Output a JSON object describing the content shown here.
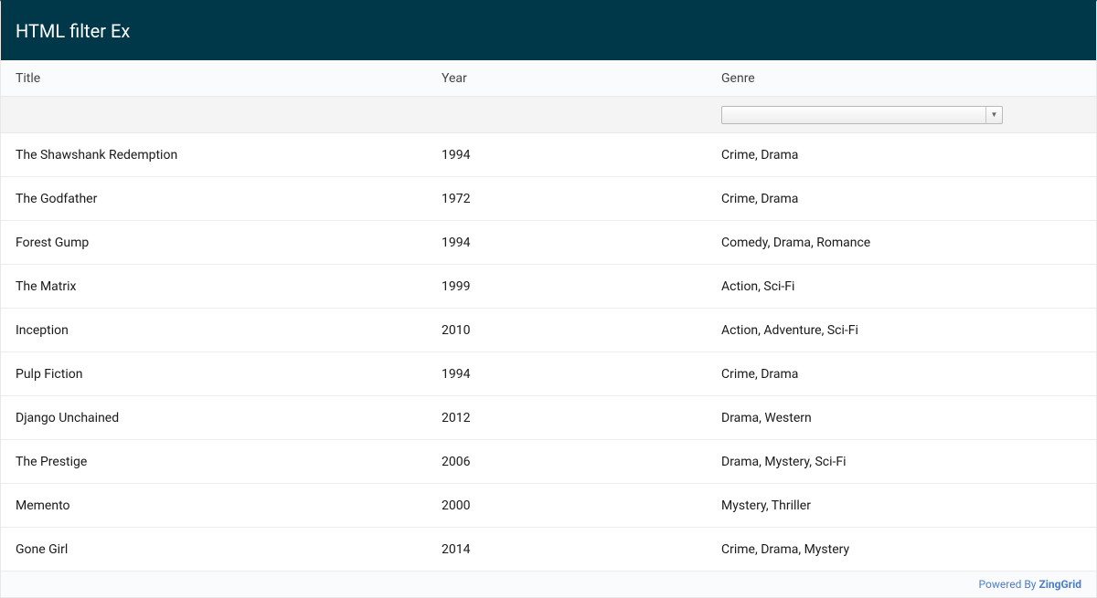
{
  "caption": "HTML filter Ex",
  "columns": {
    "title": "Title",
    "year": "Year",
    "genre": "Genre"
  },
  "rows": [
    {
      "title": "The Shawshank Redemption",
      "year": "1994",
      "genre": "Crime, Drama"
    },
    {
      "title": "The Godfather",
      "year": "1972",
      "genre": "Crime, Drama"
    },
    {
      "title": "Forest Gump",
      "year": "1994",
      "genre": "Comedy, Drama, Romance"
    },
    {
      "title": "The Matrix",
      "year": "1999",
      "genre": "Action, Sci-Fi"
    },
    {
      "title": "Inception",
      "year": "2010",
      "genre": "Action, Adventure, Sci-Fi"
    },
    {
      "title": "Pulp Fiction",
      "year": "1994",
      "genre": "Crime, Drama"
    },
    {
      "title": "Django Unchained",
      "year": "2012",
      "genre": "Drama, Western"
    },
    {
      "title": "The Prestige",
      "year": "2006",
      "genre": "Drama, Mystery, Sci-Fi"
    },
    {
      "title": "Memento",
      "year": "2000",
      "genre": "Mystery, Thriller"
    },
    {
      "title": "Gone Girl",
      "year": "2014",
      "genre": "Crime, Drama, Mystery"
    }
  ],
  "filter": {
    "genre_selected": ""
  },
  "footer": {
    "powered_by": "Powered By ",
    "brand": "ZingGrid"
  }
}
